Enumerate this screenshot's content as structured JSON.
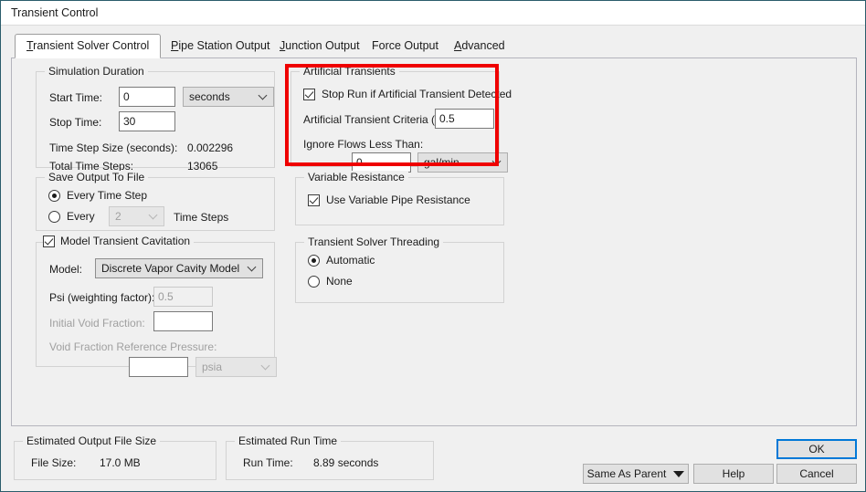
{
  "window": {
    "title": "Transient Control"
  },
  "tabs": [
    {
      "label": "Transient Solver Control",
      "mnemonic": "T",
      "active": true
    },
    {
      "label": "Pipe Station Output",
      "mnemonic": "P",
      "active": false
    },
    {
      "label": "Junction Output",
      "mnemonic": "J",
      "active": false
    },
    {
      "label": "Force Output",
      "mnemonic": "F",
      "active": false
    },
    {
      "label": "Advanced",
      "mnemonic": "A",
      "active": false
    }
  ],
  "simulation_duration": {
    "legend": "Simulation Duration",
    "start_time_label": "Start Time:",
    "start_time_value": "0",
    "start_time_units": "seconds",
    "stop_time_label": "Stop Time:",
    "stop_time_value": "30",
    "time_step_size_label": "Time Step Size (seconds):",
    "time_step_size_value": "0.002296",
    "total_time_steps_label": "Total Time Steps:",
    "total_time_steps_value": "13065"
  },
  "save_output": {
    "legend": "Save Output To File",
    "every_time_step_label": "Every Time Step",
    "every_time_step_selected": true,
    "every_label": "Every",
    "every_value": "2",
    "time_steps_label": "Time Steps",
    "every_n_selected": false
  },
  "cavitation": {
    "legend": "Model Transient Cavitation",
    "checked": true,
    "model_label": "Model:",
    "model_value": "Discrete Vapor Cavity Model",
    "psi_label": "Psi (weighting factor):",
    "psi_value": "0.5",
    "initial_void_fraction_label": "Initial Void Fraction:",
    "initial_void_fraction_value": "",
    "void_fraction_ref_pressure_label": "Void Fraction Reference Pressure:",
    "void_fraction_ref_pressure_value": "",
    "void_fraction_ref_pressure_units": "psia"
  },
  "artificial_transients": {
    "legend": "Artificial Transients",
    "highlight_color": "#ef0000",
    "stop_run_label": "Stop Run if Artificial Transient Detected",
    "stop_run_checked": true,
    "criteria_label": "Artificial Transient Criteria (%):",
    "criteria_value": "0.5",
    "ignore_flows_label": "Ignore Flows Less Than:",
    "ignore_flows_value": "0",
    "ignore_flows_units": "gal/min"
  },
  "variable_resistance": {
    "legend": "Variable Resistance",
    "use_variable_pipe_resistance_label": "Use Variable Pipe Resistance",
    "checked": true
  },
  "threading": {
    "legend": "Transient Solver Threading",
    "automatic_label": "Automatic",
    "automatic_selected": true,
    "none_label": "None",
    "none_selected": false
  },
  "estimated_output_file_size": {
    "legend": "Estimated Output File Size",
    "file_size_label": "File Size:",
    "file_size_value": "17.0 MB"
  },
  "estimated_run_time": {
    "legend": "Estimated Run Time",
    "run_time_label": "Run Time:",
    "run_time_value": "8.89 seconds"
  },
  "buttons": {
    "ok": "OK",
    "cancel": "Cancel",
    "help": "Help",
    "same_as_parent": "Same As Parent"
  }
}
